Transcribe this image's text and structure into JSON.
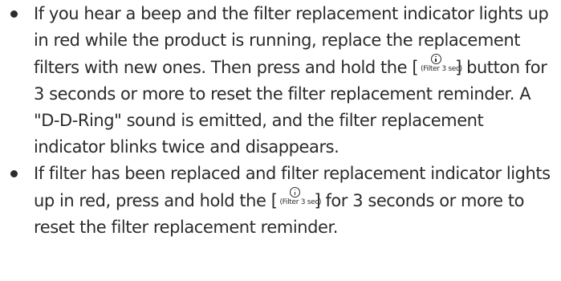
{
  "bullets": [
    {
      "text_before_button": "If you hear a beep and the filter replacement indicator lights up in red while the product is running, replace the replacement filters with new ones. Then press and hold the ",
      "button_open": "[",
      "button_caption": "(Filter 3 sec)",
      "button_close": "]",
      "text_after_button": " button for 3 seconds or more to reset the filter replacement reminder. A \"D-D-Ring\" sound is emitted, and the filter replacement indicator blinks twice and disappears."
    },
    {
      "text_before_button": "If filter has been replaced and filter replacement indicator lights up in red, press and hold the ",
      "button_open": "[",
      "button_caption": "(Filter 3 sec)",
      "button_close": "]",
      "text_after_button": " for 3 seconds or more to reset the filter replacement reminder."
    }
  ],
  "icons": {
    "bullet": "bullet-dot",
    "filter_button": "info-circle-icon"
  },
  "colors": {
    "text": "#2b2b2b",
    "background": "#ffffff"
  }
}
